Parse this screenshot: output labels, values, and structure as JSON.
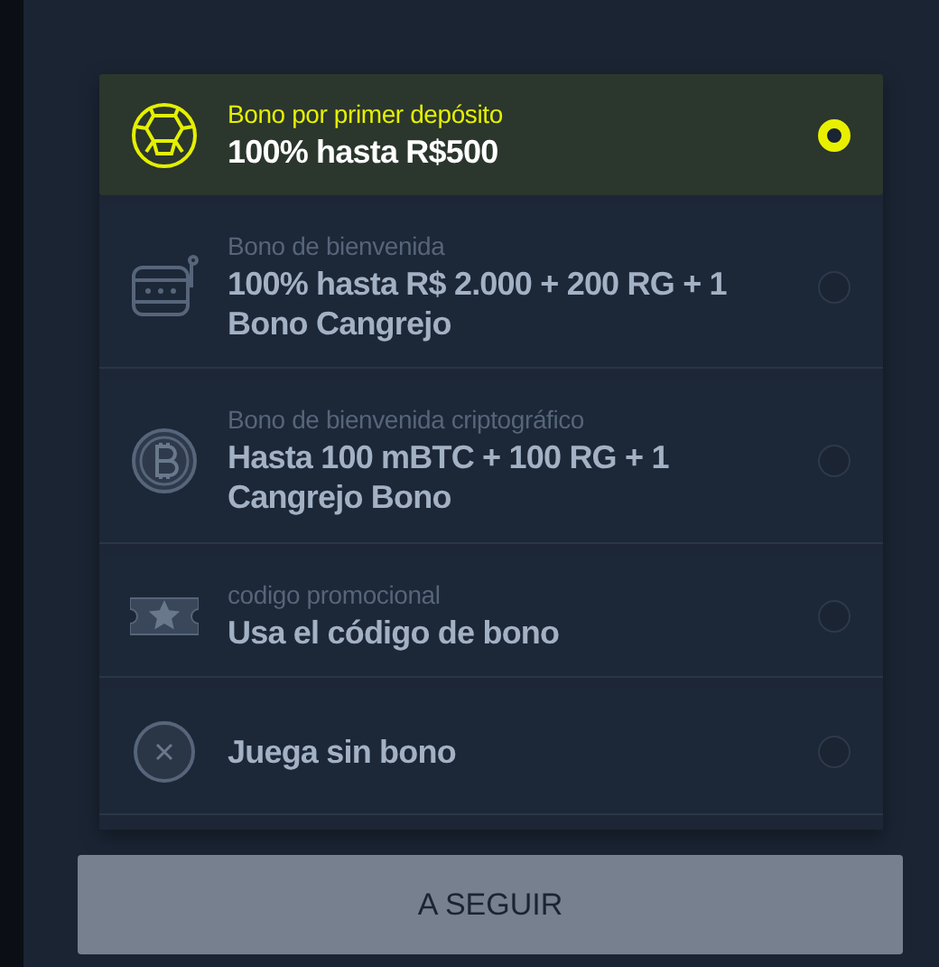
{
  "bonus_options": [
    {
      "kind": "ball",
      "subtitle": "Bono por primer depósito",
      "title": "100% hasta R$500",
      "selected": true
    },
    {
      "kind": "slot",
      "subtitle": "Bono de bienvenida",
      "title": "100% hasta R$ 2.000 + 200 RG + 1 Bono Cangrejo",
      "selected": false
    },
    {
      "kind": "bitcoin",
      "subtitle": "Bono de bienvenida criptográfico",
      "title": "Hasta 100 mBTC + 100 RG + 1 Cangrejo Bono",
      "selected": false
    },
    {
      "kind": "ticket",
      "subtitle": "codigo promocional",
      "title": "Usa el código de bono",
      "selected": false
    },
    {
      "kind": "cancel",
      "title": "Juega sin bono",
      "selected": false
    }
  ],
  "continue_button": {
    "label": "A SEGUIR"
  }
}
